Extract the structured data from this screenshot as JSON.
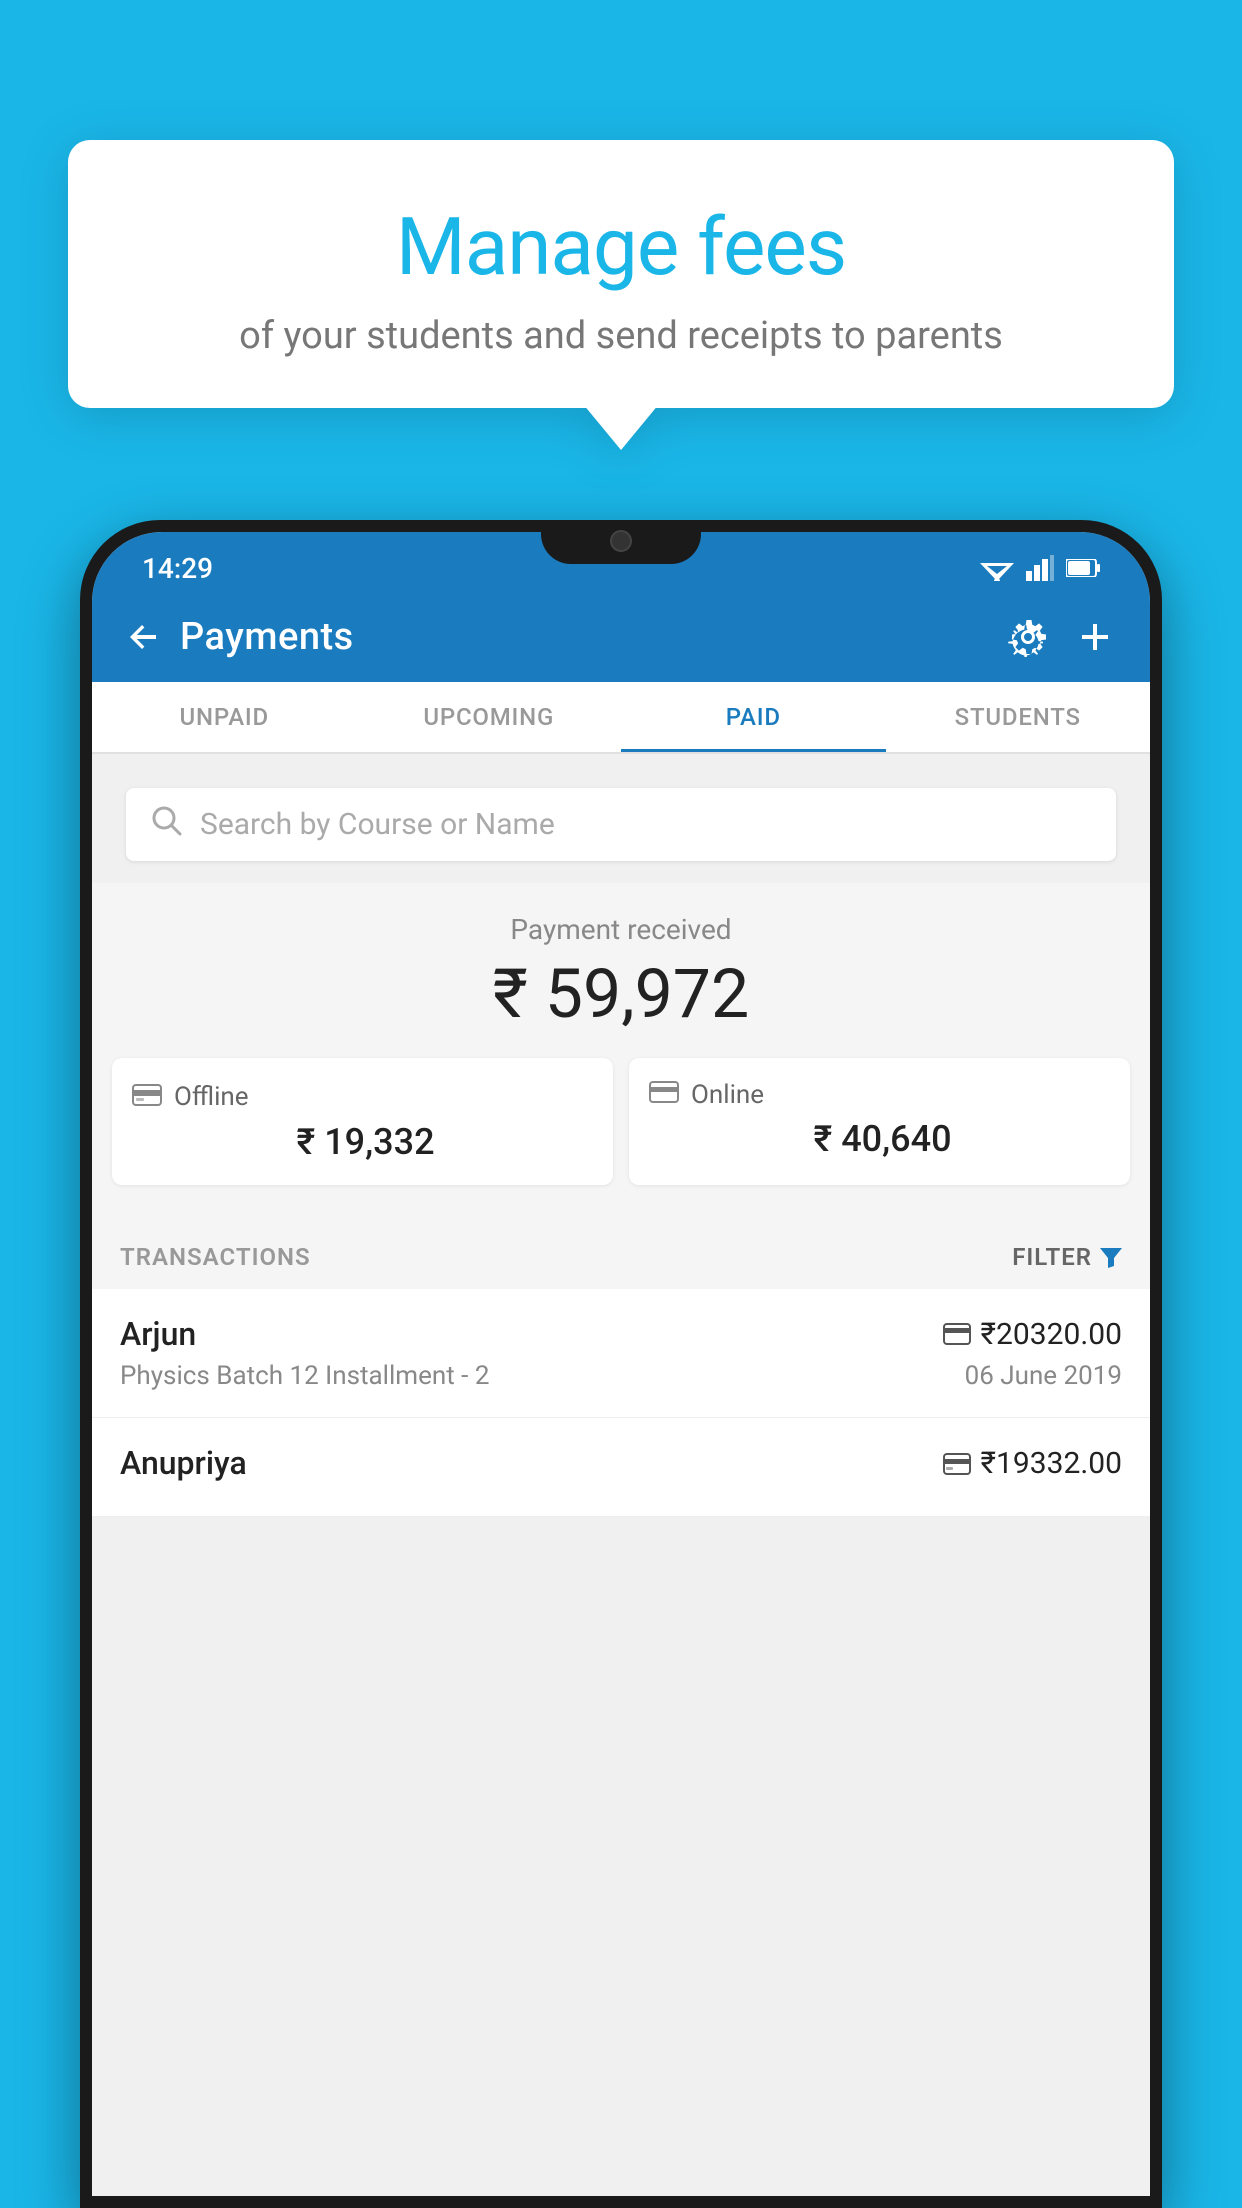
{
  "background_color": "#1ab6e8",
  "tooltip": {
    "title": "Manage fees",
    "subtitle": "of your students and send receipts to parents"
  },
  "status_bar": {
    "time": "14:29",
    "wifi_icon": "wifi-icon",
    "signal_icon": "signal-icon",
    "battery_icon": "battery-icon"
  },
  "app_bar": {
    "back_label": "←",
    "title": "Payments",
    "gear_icon": "gear-icon",
    "add_icon": "add-icon"
  },
  "tabs": [
    {
      "label": "UNPAID",
      "active": false
    },
    {
      "label": "UPCOMING",
      "active": false
    },
    {
      "label": "PAID",
      "active": true
    },
    {
      "label": "STUDENTS",
      "active": false
    }
  ],
  "search": {
    "placeholder": "Search by Course or Name"
  },
  "payment_summary": {
    "received_label": "Payment received",
    "total_amount": "₹ 59,972",
    "offline_label": "Offline",
    "offline_amount": "₹ 19,332",
    "online_label": "Online",
    "online_amount": "₹ 40,640"
  },
  "transactions": {
    "header_label": "TRANSACTIONS",
    "filter_label": "FILTER",
    "items": [
      {
        "name": "Arjun",
        "amount": "₹20320.00",
        "course": "Physics Batch 12 Installment - 2",
        "date": "06 June 2019",
        "payment_type": "online"
      },
      {
        "name": "Anupriya",
        "amount": "₹19332.00",
        "course": "",
        "date": "",
        "payment_type": "offline"
      }
    ]
  }
}
